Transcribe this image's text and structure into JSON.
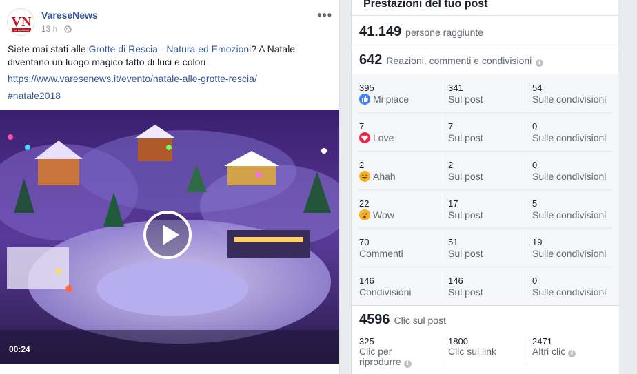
{
  "post": {
    "page_name": "VareseNews",
    "time": "13 h",
    "text_before": "Siete mai stati alle ",
    "text_link": "Grotte di Rescia - Natura ed Emozioni",
    "text_after": "? A Natale diventano un luogo magico fatto di luci e colori",
    "url": "https://www.varesenews.it/evento/natale-alle-grotte-rescia/",
    "hashtag": "#natale2018",
    "more_label": "•••",
    "video": {
      "duration": "00:24"
    },
    "avatar_text": "VN",
    "avatar_subtext": "VareseNews"
  },
  "panel": {
    "title": "Prestazioni del tuo post",
    "reach": {
      "value": "41.149",
      "label": "persone raggiunte"
    },
    "reactions": {
      "value": "642",
      "label": "Reazioni, commenti e condivisioni"
    },
    "rows": [
      {
        "icon": "like-icon",
        "label": "Mi piace",
        "total": "395",
        "on_post": "341",
        "on_post_label": "Sul post",
        "on_shares": "54",
        "on_shares_label": "Sulle condivisioni"
      },
      {
        "icon": "love-icon",
        "label": "Love",
        "total": "7",
        "on_post": "7",
        "on_post_label": "Sul post",
        "on_shares": "0",
        "on_shares_label": "Sulle condivisioni"
      },
      {
        "icon": "haha-icon",
        "label": "Ahah",
        "total": "2",
        "on_post": "2",
        "on_post_label": "Sul post",
        "on_shares": "0",
        "on_shares_label": "Sulle condivisioni"
      },
      {
        "icon": "wow-icon",
        "label": "Wow",
        "total": "22",
        "on_post": "17",
        "on_post_label": "Sul post",
        "on_shares": "5",
        "on_shares_label": "Sulle condivisioni"
      },
      {
        "icon": "",
        "label": "Commenti",
        "total": "70",
        "on_post": "51",
        "on_post_label": "Sul post",
        "on_shares": "19",
        "on_shares_label": "Sulle condivisioni"
      },
      {
        "icon": "",
        "label": "Condivisioni",
        "total": "146",
        "on_post": "146",
        "on_post_label": "Sul post",
        "on_shares": "0",
        "on_shares_label": "Sulle condivisioni"
      }
    ],
    "clicks": {
      "value": "4596",
      "label": "Clic sul post",
      "items": [
        {
          "value": "325",
          "label": "Clic per riprodurre"
        },
        {
          "value": "1800",
          "label": "Clic sul link"
        },
        {
          "value": "2471",
          "label": "Altri clic"
        }
      ]
    }
  },
  "colors": {
    "link": "#365899",
    "like": "#4080ff",
    "love": "#f0284a",
    "haha": "#f7b125"
  }
}
